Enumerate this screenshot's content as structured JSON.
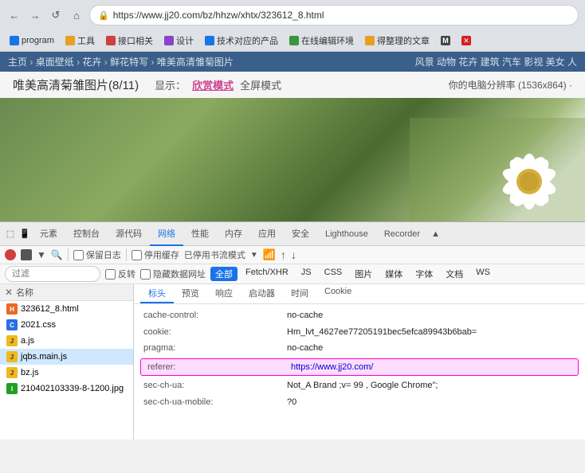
{
  "browser": {
    "url": "https://www.jj20.com/bz/hhzw/xhtx/323612_8.html",
    "back_btn": "←",
    "forward_btn": "→",
    "reload_btn": "↺",
    "home_btn": "⌂",
    "bookmarks": [
      {
        "label": "program",
        "color": "blue2"
      },
      {
        "label": "工具",
        "color": "orange"
      },
      {
        "label": "接口相关",
        "color": "red"
      },
      {
        "label": "设计",
        "color": "purple"
      },
      {
        "label": "技术对应的产品",
        "color": "blue2"
      },
      {
        "label": "在线编辑环境",
        "color": "green"
      },
      {
        "label": "得整理的文章",
        "color": "orange"
      },
      {
        "label": "M",
        "color": "m"
      },
      {
        "label": "X",
        "color": "x-ico"
      }
    ]
  },
  "site_nav": {
    "breadcrumbs": [
      "主页",
      "桌面壁纸",
      "花卉",
      "鲜花特写",
      "唯美高清雏菊图片"
    ],
    "sep": "›"
  },
  "cat_nav": {
    "items": [
      "风景",
      "动物",
      "花卉",
      "建筑",
      "汽车",
      "影视",
      "美女",
      "人"
    ]
  },
  "page": {
    "title": "唯美高清菊雏图片(8/11)",
    "display_label": "显示：",
    "view_mode": "欣赏模式",
    "fullscreen": "全屏模式",
    "resolution_label": "你的电脑分辨率",
    "resolution": "(1536x864)",
    "more": "·"
  },
  "devtools": {
    "tabs": [
      {
        "label": "元素"
      },
      {
        "label": "控制台"
      },
      {
        "label": "源代码"
      },
      {
        "label": "网络",
        "active": true
      },
      {
        "label": "性能"
      },
      {
        "label": "内存"
      },
      {
        "label": "应用"
      },
      {
        "label": "安全"
      },
      {
        "label": "Lighthouse"
      },
      {
        "label": "Recorder"
      }
    ],
    "toolbar": {
      "preserve_log": "保留日志",
      "disable_cache": "停用缓存",
      "offline_mode": "已停用书流模式",
      "invert": "反转",
      "hide_data_urls": "隐藏数据网址",
      "all_filter": "全部",
      "filter_placeholder": "过滤"
    },
    "type_filters": [
      "Fetch/XHR",
      "JS",
      "CSS",
      "图片",
      "媒体",
      "字体",
      "文档",
      "WS"
    ],
    "headers_tabs": [
      "标头",
      "预览",
      "响应",
      "启动器",
      "时间",
      "Cookie"
    ],
    "columns": {
      "name": "名称",
      "header_col": "标头",
      "preview_col": "预览",
      "response_col": "响应",
      "initiator_col": "启动器",
      "time_col": "时间",
      "cookie_col": "Cookie"
    },
    "files": [
      {
        "name": "323612_8.html",
        "type": "html"
      },
      {
        "name": "2021.css",
        "type": "css"
      },
      {
        "name": "a.js",
        "type": "js"
      },
      {
        "name": "jqbs.main.js",
        "type": "js"
      },
      {
        "name": "bz.js",
        "type": "js"
      },
      {
        "name": "210402103339-8-1200.jpg",
        "type": "img"
      }
    ],
    "selected_file": "jqbs.main.js",
    "headers": [
      {
        "name": "cache-control:",
        "value": "no-cache"
      },
      {
        "name": "cookie:",
        "value": "Hm_lvt_4627ee77205191bec5efca89943b6bab=",
        "long": true
      },
      {
        "name": "pragma:",
        "value": "no-cache"
      },
      {
        "name": "referer:",
        "value": "https://www.jj20.com/",
        "highlighted": true
      },
      {
        "name": "sec-ch-ua:",
        "value": "Not_A Brand ;v= 99 ,  Google Chrome\";",
        "long": true
      },
      {
        "name": "sec-ch-ua-mobile:",
        "value": "?0"
      }
    ]
  }
}
